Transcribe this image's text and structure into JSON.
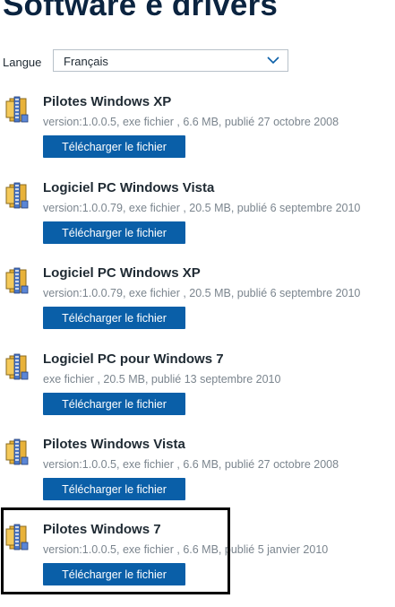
{
  "page": {
    "title": "Software e drivers"
  },
  "language": {
    "label": "Langue",
    "selected": "Français"
  },
  "items": [
    {
      "title": "Pilotes Windows XP",
      "meta": "version:1.0.0.5, exe fichier , 6.6 MB, publié 27 octobre 2008",
      "button": "Télécharger le fichier"
    },
    {
      "title": "Logiciel PC Windows Vista",
      "meta": "version:1.0.0.79, exe fichier , 20.5 MB, publié 6 septembre 2010",
      "button": "Télécharger le fichier"
    },
    {
      "title": "Logiciel PC Windows XP",
      "meta": "version:1.0.0.79, exe fichier , 20.5 MB, publié 6 septembre 2010",
      "button": "Télécharger le fichier"
    },
    {
      "title": "Logiciel PC pour Windows 7",
      "meta": "exe fichier , 20.5 MB, publié 13 septembre 2010",
      "button": "Télécharger le fichier"
    },
    {
      "title": "Pilotes Windows Vista",
      "meta": "version:1.0.0.5, exe fichier , 6.6 MB, publié 27 octobre 2008",
      "button": "Télécharger le fichier"
    },
    {
      "title": "Pilotes Windows 7",
      "meta": "version:1.0.0.5, exe fichier , 6.6 MB, publié 5 janvier 2010",
      "button": "Télécharger le fichier"
    }
  ],
  "icons": {
    "file": "archive-file-icon",
    "dropdown": "chevron-down-icon"
  },
  "colors": {
    "accent": "#0a5fa8",
    "title": "#0b2440",
    "meta": "#7b858e",
    "highlight": "#000000"
  }
}
